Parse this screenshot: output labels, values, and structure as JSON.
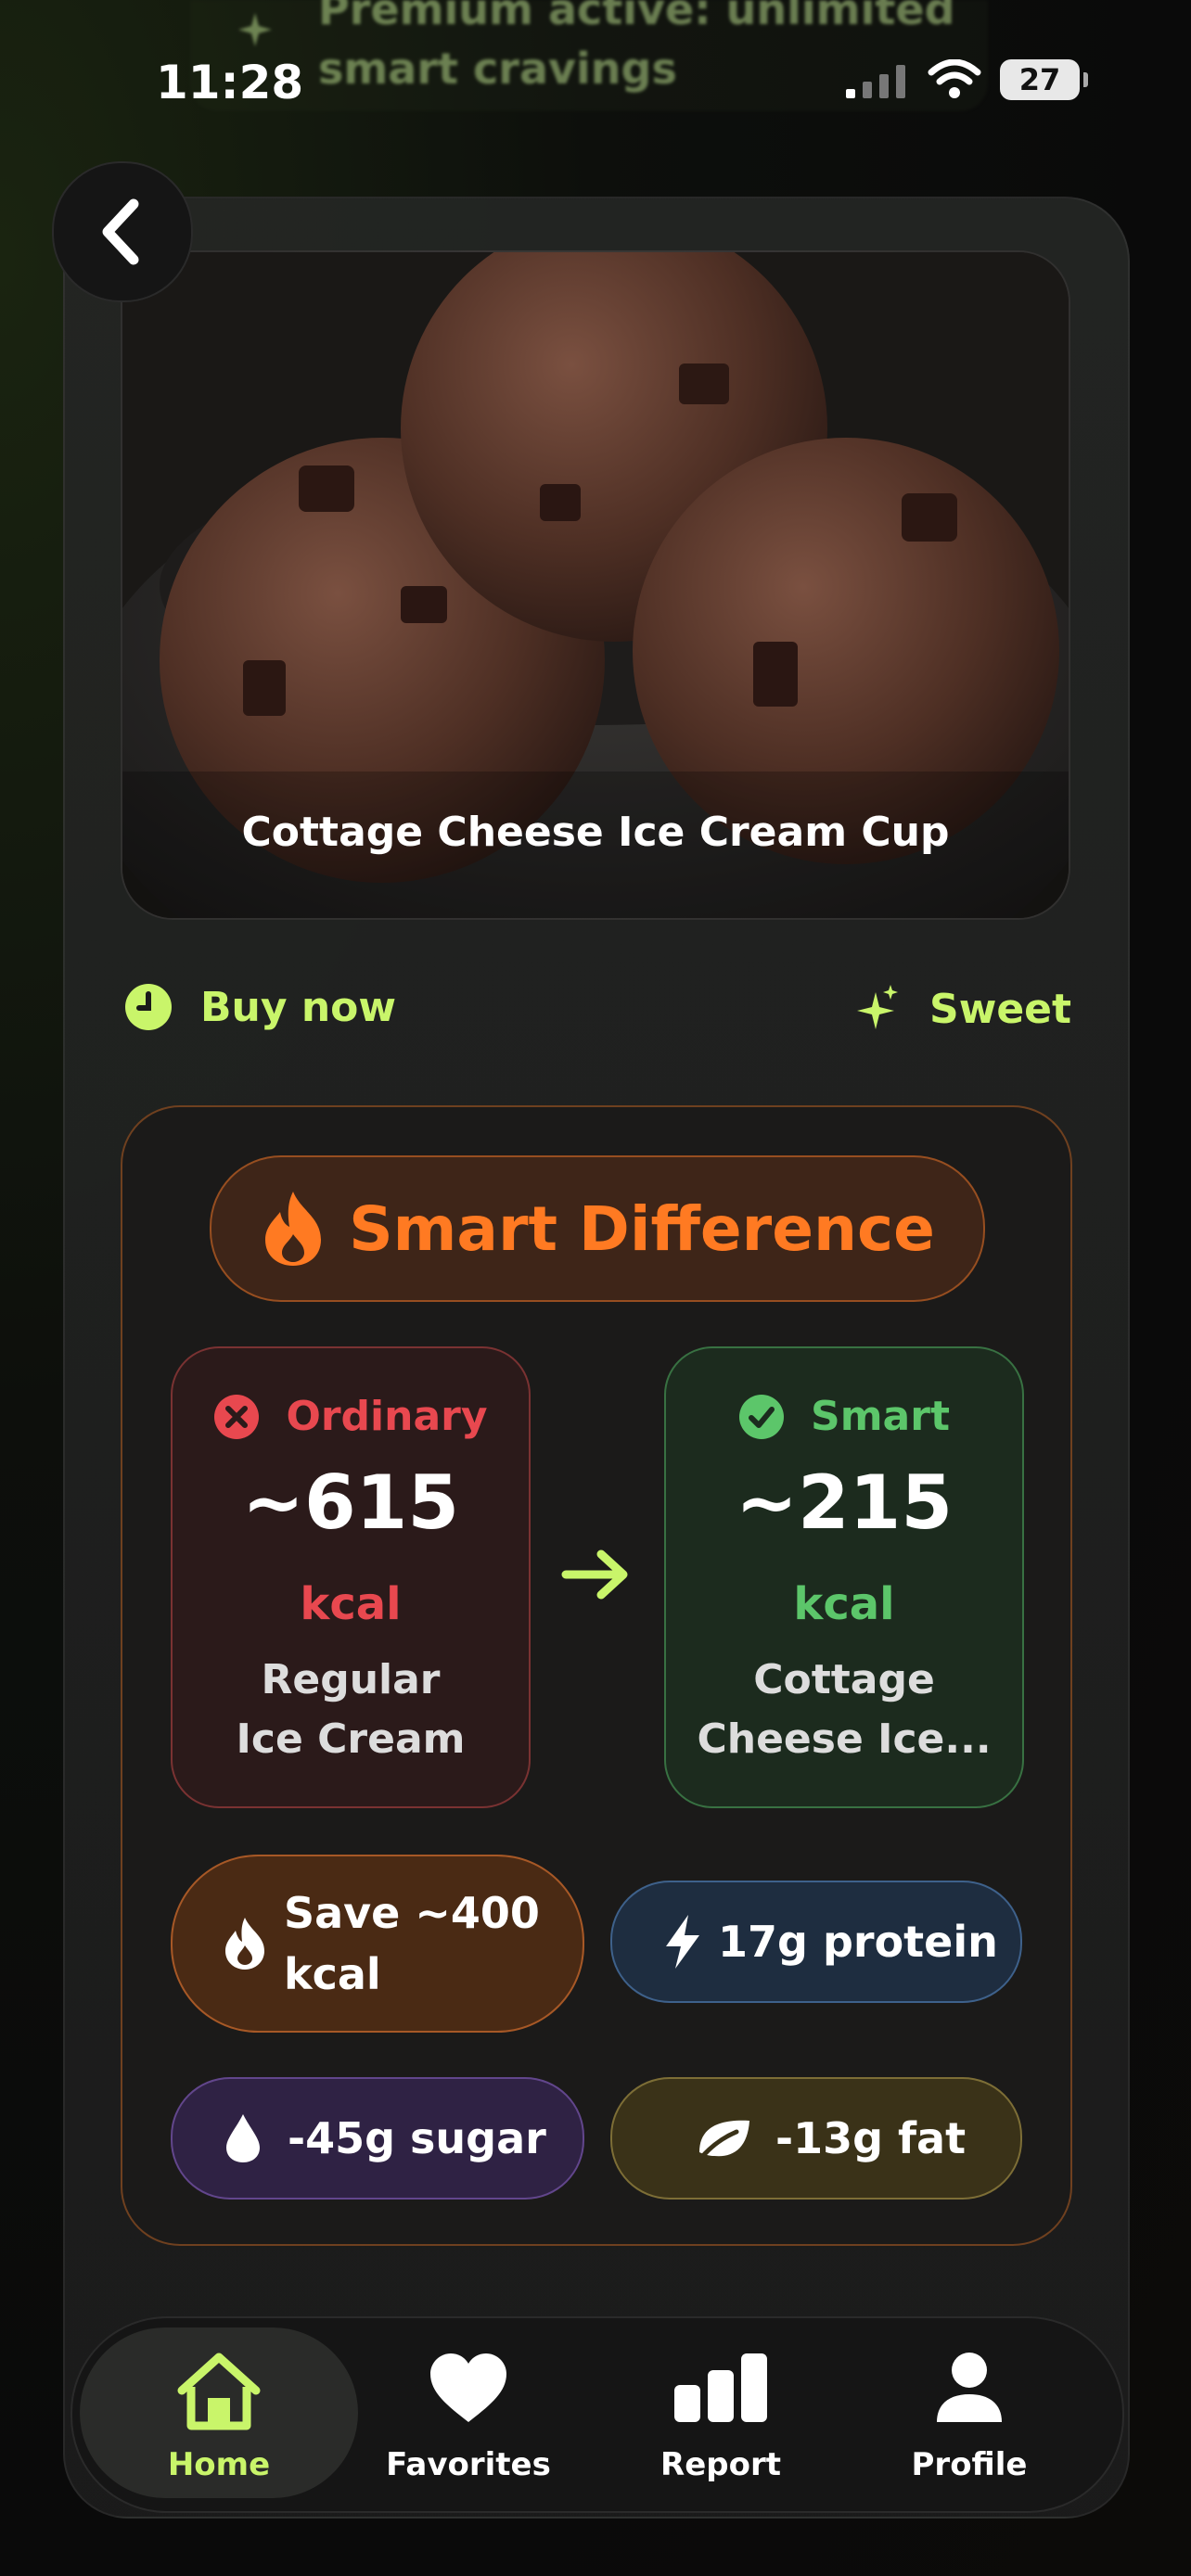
{
  "status_bar": {
    "time": "11:28",
    "battery": "27"
  },
  "banner": {
    "text": "Premium active: unlimited smart cravings"
  },
  "recipe": {
    "title": "Cottage Cheese Ice Cream Cup",
    "timing": "Buy now",
    "category": "Sweet"
  },
  "difference": {
    "header": "Smart Difference",
    "ordinary": {
      "label": "Ordinary",
      "kcal": "~615",
      "unit": "kcal",
      "name_line1": "Regular",
      "name_line2": "Ice Cream"
    },
    "smart": {
      "label": "Smart",
      "kcal": "~215",
      "unit": "kcal",
      "name_line1": "Cottage",
      "name_line2": "Cheese Ice..."
    },
    "chips": {
      "save_line1": "Save ~400",
      "save_line2": "kcal",
      "protein": "17g protein",
      "sugar": "-45g sugar",
      "fat": "-13g fat"
    }
  },
  "tabbar": {
    "items": [
      {
        "label": "Home"
      },
      {
        "label": "Favorites"
      },
      {
        "label": "Report"
      },
      {
        "label": "Profile"
      }
    ]
  },
  "colors": {
    "accent": "#c9f56a",
    "orange": "#ff7a22",
    "ordinary": "#e8484f",
    "smart": "#5cc66a"
  }
}
